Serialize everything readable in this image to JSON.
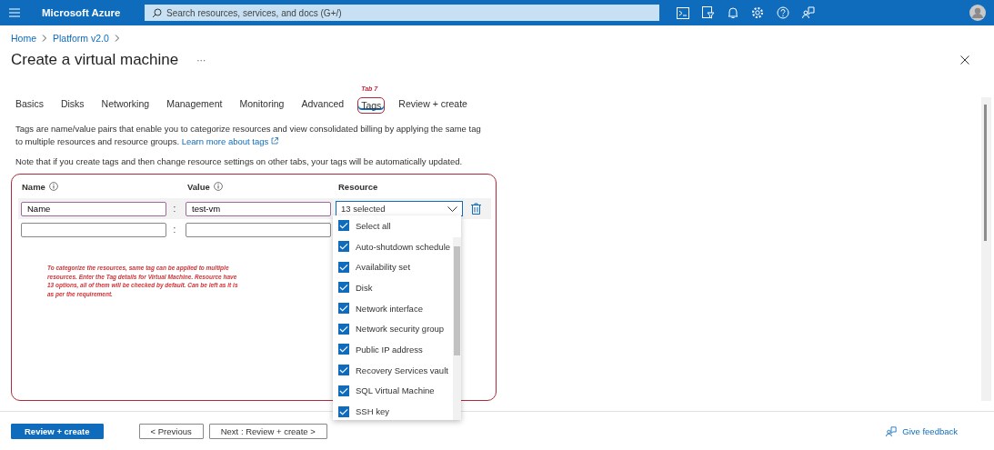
{
  "header": {
    "brand": "Microsoft Azure",
    "search": {
      "placeholder": "Search resources, services, and docs (G+/)"
    }
  },
  "breadcrumb": [
    "Home",
    "Platform v2.0"
  ],
  "title": "Create a virtual machine",
  "more": "···",
  "tabs": [
    {
      "label": "Basics",
      "selected": false
    },
    {
      "label": "Disks",
      "selected": false
    },
    {
      "label": "Networking",
      "selected": false
    },
    {
      "label": "Management",
      "selected": false
    },
    {
      "label": "Monitoring",
      "selected": false
    },
    {
      "label": "Advanced",
      "selected": false
    },
    {
      "label": "Tags",
      "selected": true
    },
    {
      "label": "Review + create",
      "selected": false
    }
  ],
  "tab_annotation": "Tab 7",
  "description": {
    "text": "Tags are name/value pairs that enable you to categorize resources and view consolidated billing by applying the same tag to multiple resources and resource groups.",
    "link": "Learn more about tags"
  },
  "note": "Note that if you create tags and then change resource settings on other tabs, your tags will be automatically updated.",
  "tag_table": {
    "separator": ":",
    "columns": [
      {
        "label": "Name",
        "info": true
      },
      {
        "label": "Value",
        "info": true
      },
      {
        "label": "Resource",
        "info": false
      }
    ],
    "rows": [
      {
        "kind": "filled",
        "name": "Name",
        "value": "test-vm",
        "resource": "13 selected"
      },
      {
        "kind": "new"
      }
    ]
  },
  "resource_dropdown": {
    "options": [
      {
        "label": "Select all",
        "checked": true
      },
      {
        "label": "Auto-shutdown schedule",
        "checked": true
      },
      {
        "label": "Availability set",
        "checked": true
      },
      {
        "label": "Disk",
        "checked": true
      },
      {
        "label": "Network interface",
        "checked": true
      },
      {
        "label": "Network security group",
        "checked": true
      },
      {
        "label": "Public IP address",
        "checked": true
      },
      {
        "label": "Recovery Services vault",
        "checked": true
      },
      {
        "label": "SQL Virtual Machine",
        "checked": true
      },
      {
        "label": "SSH key",
        "checked": true
      }
    ]
  },
  "annotation": "To categorize the resources, same tag can be applied to multiple resources. Enter the Tag details for Virtual Machine. Resource have 13 options, all of them will be checked by default. Can be left as it is as per the requirement.",
  "footer": {
    "buttons": [
      {
        "label": "Review + create",
        "kind": "primary"
      },
      {
        "label": "< Previous",
        "kind": "secondary"
      },
      {
        "label": "Next : Review + create >",
        "kind": "secondary"
      }
    ],
    "feedback": "Give feedback"
  }
}
